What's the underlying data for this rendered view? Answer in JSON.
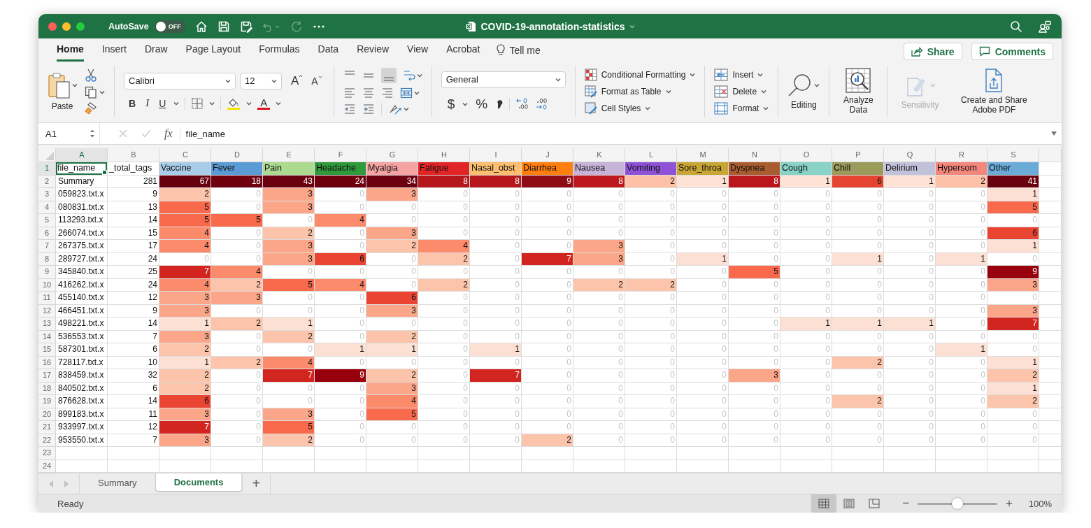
{
  "title_bar": {
    "autosave_label": "AutoSave",
    "autosave": {
      "label": "OFF",
      "on": false
    },
    "document_title": "COVID-19-annotation-statistics"
  },
  "menu_tabs": [
    {
      "label": "Home",
      "selected": true
    },
    {
      "label": "Insert",
      "selected": false
    },
    {
      "label": "Draw",
      "selected": false
    },
    {
      "label": "Page Layout",
      "selected": false
    },
    {
      "label": "Formulas",
      "selected": false
    },
    {
      "label": "Data",
      "selected": false
    },
    {
      "label": "Review",
      "selected": false
    },
    {
      "label": "View",
      "selected": false
    },
    {
      "label": "Acrobat",
      "selected": false
    }
  ],
  "tell_me": "Tell me",
  "header_buttons": [
    {
      "kind": "share",
      "label": "Share"
    },
    {
      "kind": "comments",
      "label": "Comments"
    }
  ],
  "ribbon": {
    "paste": "Paste",
    "font_name": "Calibri",
    "font_size": "12",
    "grow_font": "A",
    "shrink_font": "A",
    "bold": "B",
    "italic": "I",
    "underline": "U",
    "font_color": "A",
    "number_format": "General",
    "currency": "$",
    "percent": "%",
    "styles": [
      {
        "kind": "conditional",
        "label": "Conditional Formatting"
      },
      {
        "kind": "table",
        "label": "Format as Table"
      },
      {
        "kind": "cellstyles",
        "label": "Cell Styles"
      }
    ],
    "cells": [
      {
        "kind": "insert",
        "label": "Insert"
      },
      {
        "kind": "delete",
        "label": "Delete"
      },
      {
        "kind": "format",
        "label": "Format"
      }
    ],
    "editing": "Editing",
    "analyze": "Analyze Data",
    "sensitivity": {
      "label": "Sensitivity",
      "disabled": true
    },
    "adobe": "Create and Share Adobe PDF"
  },
  "formula_bar": {
    "name_box": "A1",
    "fx": "fx",
    "content": "file_name"
  },
  "sheet": {
    "column_letters": [
      "A",
      "B",
      "C",
      "D",
      "E",
      "F",
      "G",
      "H",
      "I",
      "J",
      "K",
      "L",
      "M",
      "N",
      "O",
      "P",
      "Q",
      "R",
      "S"
    ],
    "row_numbers": [
      "1",
      "2",
      "3",
      "4",
      "5",
      "6",
      "7",
      "8",
      "9",
      "10",
      "11",
      "12",
      "13",
      "14",
      "15",
      "16",
      "17",
      "18",
      "19",
      "20",
      "21",
      "22",
      "23",
      "24"
    ],
    "header_row": [
      {
        "text": "file_name",
        "color": "#ffffff",
        "selected": true
      },
      {
        "text": "_total_tags",
        "color": "#ffffff",
        "selected": false
      },
      {
        "text": "Vaccine",
        "color": "#a9cde8",
        "selected": false
      },
      {
        "text": "Fever",
        "color": "#5b9bd5",
        "selected": false
      },
      {
        "text": "Pain",
        "color": "#acda8e",
        "selected": false
      },
      {
        "text": "Headache",
        "color": "#2f9a3c",
        "selected": false
      },
      {
        "text": "Myalgia",
        "color": "#f5a3a3",
        "selected": false
      },
      {
        "text": "Fatigue",
        "color": "#e32426",
        "selected": false
      },
      {
        "text": "Nasal_obst",
        "color": "#fdbf6f",
        "selected": false
      },
      {
        "text": "Diarrhea",
        "color": "#ff7f0e",
        "selected": false
      },
      {
        "text": "Nausea",
        "color": "#c7b2d8",
        "selected": false
      },
      {
        "text": "Vomiting",
        "color": "#8f52d6",
        "selected": false
      },
      {
        "text": "Sore_throa",
        "color": "#c9a634",
        "selected": false
      },
      {
        "text": "Dyspnea",
        "color": "#a95c2e",
        "selected": false
      },
      {
        "text": "Cough",
        "color": "#88d2c7",
        "selected": false
      },
      {
        "text": "Chill",
        "color": "#9b9b5c",
        "selected": false
      },
      {
        "text": "Delirium",
        "color": "#c2c1da",
        "selected": false
      },
      {
        "text": "Hypersom",
        "color": "#f4877c",
        "selected": false
      },
      {
        "text": "Other",
        "color": "#6babd8",
        "selected": false
      }
    ],
    "rows": [
      {
        "file_name": "Summary",
        "total_tags": "281",
        "cells": [
          {
            "text": "67",
            "color": "#67000d"
          },
          {
            "text": "18",
            "color": "#6f010f"
          },
          {
            "text": "43",
            "color": "#6a000e"
          },
          {
            "text": "24",
            "color": "#6e000e"
          },
          {
            "text": "34",
            "color": "#6c000e"
          },
          {
            "text": "8",
            "color": "#b5171c"
          },
          {
            "text": "8",
            "color": "#b5171c"
          },
          {
            "text": "9",
            "color": "#8e0c13"
          },
          {
            "text": "8",
            "color": "#bd181d"
          },
          {
            "text": "2",
            "color": "#fcc1a6"
          },
          {
            "text": "1",
            "color": "#fee2d6"
          },
          {
            "text": "8",
            "color": "#ba171c"
          },
          {
            "text": "1",
            "color": "#fee2d6"
          },
          {
            "text": "6",
            "color": "#e54431"
          },
          {
            "text": "1",
            "color": "#fee2d6"
          },
          {
            "text": "2",
            "color": "#fcc1a6"
          },
          {
            "text": "41",
            "color": "#68000e"
          }
        ]
      },
      {
        "file_name": "059823.txt.x",
        "total_tags": "9",
        "cells": [
          {
            "text": "2",
            "color": "#fcc4ab"
          },
          {
            "text": "0"
          },
          {
            "text": "3",
            "color": "#fca689"
          },
          {
            "text": "0"
          },
          {
            "text": "3",
            "color": "#fca689"
          },
          {
            "text": "0"
          },
          {
            "text": "0"
          },
          {
            "text": "0"
          },
          {
            "text": "0"
          },
          {
            "text": "0"
          },
          {
            "text": "0"
          },
          {
            "text": "0"
          },
          {
            "text": "0"
          },
          {
            "text": "0"
          },
          {
            "text": "0"
          },
          {
            "text": "0"
          },
          {
            "text": "1",
            "color": "#fde0d4"
          }
        ]
      },
      {
        "file_name": "080831.txt.x",
        "total_tags": "13",
        "cells": [
          {
            "text": "5",
            "color": "#f96a4c"
          },
          {
            "text": "0"
          },
          {
            "text": "3",
            "color": "#fca689"
          },
          {
            "text": "0"
          },
          {
            "text": "0"
          },
          {
            "text": "0"
          },
          {
            "text": "0"
          },
          {
            "text": "0"
          },
          {
            "text": "0"
          },
          {
            "text": "0"
          },
          {
            "text": "0"
          },
          {
            "text": "0"
          },
          {
            "text": "0"
          },
          {
            "text": "0"
          },
          {
            "text": "0"
          },
          {
            "text": "0"
          },
          {
            "text": "5",
            "color": "#f96a4c"
          }
        ]
      },
      {
        "file_name": "113293.txt.x",
        "total_tags": "14",
        "cells": [
          {
            "text": "5",
            "color": "#f96a4c"
          },
          {
            "text": "5",
            "color": "#f96a4c"
          },
          {
            "text": "0"
          },
          {
            "text": "4",
            "color": "#fc8b6c"
          },
          {
            "text": "0"
          },
          {
            "text": "0"
          },
          {
            "text": "0"
          },
          {
            "text": "0"
          },
          {
            "text": "0"
          },
          {
            "text": "0"
          },
          {
            "text": "0"
          },
          {
            "text": "0"
          },
          {
            "text": "0"
          },
          {
            "text": "0"
          },
          {
            "text": "0"
          },
          {
            "text": "0"
          },
          {
            "text": "0"
          }
        ]
      },
      {
        "file_name": "266074.txt.x",
        "total_tags": "15",
        "cells": [
          {
            "text": "4",
            "color": "#fc8b6c"
          },
          {
            "text": "0"
          },
          {
            "text": "2",
            "color": "#fcc4ab"
          },
          {
            "text": "0"
          },
          {
            "text": "3",
            "color": "#fca689"
          },
          {
            "text": "0"
          },
          {
            "text": "0"
          },
          {
            "text": "0"
          },
          {
            "text": "0"
          },
          {
            "text": "0"
          },
          {
            "text": "0"
          },
          {
            "text": "0"
          },
          {
            "text": "0"
          },
          {
            "text": "0"
          },
          {
            "text": "0"
          },
          {
            "text": "0"
          },
          {
            "text": "6",
            "color": "#ea4532"
          }
        ]
      },
      {
        "file_name": "267375.txt.x",
        "total_tags": "17",
        "cells": [
          {
            "text": "4",
            "color": "#fc8b6c"
          },
          {
            "text": "0"
          },
          {
            "text": "3",
            "color": "#fca689"
          },
          {
            "text": "0"
          },
          {
            "text": "2",
            "color": "#fcc4ab"
          },
          {
            "text": "4",
            "color": "#fc8b6c"
          },
          {
            "text": "0"
          },
          {
            "text": "0"
          },
          {
            "text": "3",
            "color": "#fca689"
          },
          {
            "text": "0"
          },
          {
            "text": "0"
          },
          {
            "text": "0"
          },
          {
            "text": "0"
          },
          {
            "text": "0"
          },
          {
            "text": "0"
          },
          {
            "text": "0"
          },
          {
            "text": "1",
            "color": "#fde0d4"
          }
        ]
      },
      {
        "file_name": "289727.txt.x",
        "total_tags": "24",
        "cells": [
          {
            "text": "0"
          },
          {
            "text": "0"
          },
          {
            "text": "3",
            "color": "#fca689"
          },
          {
            "text": "6",
            "color": "#ea4532"
          },
          {
            "text": "0"
          },
          {
            "text": "2",
            "color": "#fcc4ab"
          },
          {
            "text": "0"
          },
          {
            "text": "7",
            "color": "#d3251f"
          },
          {
            "text": "3",
            "color": "#fca689"
          },
          {
            "text": "0"
          },
          {
            "text": "1",
            "color": "#fde0d4"
          },
          {
            "text": "0"
          },
          {
            "text": "0"
          },
          {
            "text": "1",
            "color": "#fde0d4"
          },
          {
            "text": "0"
          },
          {
            "text": "1",
            "color": "#fde0d4"
          },
          {
            "text": "0"
          }
        ]
      },
      {
        "file_name": "345840.txt.x",
        "total_tags": "25",
        "cells": [
          {
            "text": "7",
            "color": "#d3251f"
          },
          {
            "text": "4",
            "color": "#fc8b6c"
          },
          {
            "text": "0"
          },
          {
            "text": "0"
          },
          {
            "text": "0"
          },
          {
            "text": "0"
          },
          {
            "text": "0"
          },
          {
            "text": "0"
          },
          {
            "text": "0"
          },
          {
            "text": "0"
          },
          {
            "text": "0"
          },
          {
            "text": "5",
            "color": "#f96a4c"
          },
          {
            "text": "0"
          },
          {
            "text": "0"
          },
          {
            "text": "0"
          },
          {
            "text": "0"
          },
          {
            "text": "9",
            "color": "#99000d"
          }
        ]
      },
      {
        "file_name": "416262.txt.x",
        "total_tags": "24",
        "cells": [
          {
            "text": "4",
            "color": "#fc8b6c"
          },
          {
            "text": "2",
            "color": "#fcc4ab"
          },
          {
            "text": "5",
            "color": "#f96a4c"
          },
          {
            "text": "4",
            "color": "#fc8b6c"
          },
          {
            "text": "0"
          },
          {
            "text": "2",
            "color": "#fcc4ab"
          },
          {
            "text": "0"
          },
          {
            "text": "0"
          },
          {
            "text": "2",
            "color": "#fcc4ab"
          },
          {
            "text": "2",
            "color": "#fcc4ab"
          },
          {
            "text": "0"
          },
          {
            "text": "0"
          },
          {
            "text": "0"
          },
          {
            "text": "0"
          },
          {
            "text": "0"
          },
          {
            "text": "0"
          },
          {
            "text": "3",
            "color": "#fca689"
          }
        ]
      },
      {
        "file_name": "455140.txt.x",
        "total_tags": "12",
        "cells": [
          {
            "text": "3",
            "color": "#fca689"
          },
          {
            "text": "3",
            "color": "#fca689"
          },
          {
            "text": "0"
          },
          {
            "text": "0"
          },
          {
            "text": "6",
            "color": "#ea4532"
          },
          {
            "text": "0"
          },
          {
            "text": "0"
          },
          {
            "text": "0"
          },
          {
            "text": "0"
          },
          {
            "text": "0"
          },
          {
            "text": "0"
          },
          {
            "text": "0"
          },
          {
            "text": "0"
          },
          {
            "text": "0"
          },
          {
            "text": "0"
          },
          {
            "text": "0"
          },
          {
            "text": "0"
          }
        ]
      },
      {
        "file_name": "466451.txt.x",
        "total_tags": "9",
        "cells": [
          {
            "text": "3",
            "color": "#fca689"
          },
          {
            "text": "0"
          },
          {
            "text": "0"
          },
          {
            "text": "0"
          },
          {
            "text": "3",
            "color": "#fca689"
          },
          {
            "text": "0"
          },
          {
            "text": "0"
          },
          {
            "text": "0"
          },
          {
            "text": "0"
          },
          {
            "text": "0"
          },
          {
            "text": "0"
          },
          {
            "text": "0"
          },
          {
            "text": "0"
          },
          {
            "text": "0"
          },
          {
            "text": "0"
          },
          {
            "text": "0"
          },
          {
            "text": "3",
            "color": "#fca689"
          }
        ]
      },
      {
        "file_name": "498221.txt.x",
        "total_tags": "14",
        "cells": [
          {
            "text": "1",
            "color": "#fde0d4"
          },
          {
            "text": "2",
            "color": "#fcc4ab"
          },
          {
            "text": "1",
            "color": "#fde0d4"
          },
          {
            "text": "0"
          },
          {
            "text": "0"
          },
          {
            "text": "0"
          },
          {
            "text": "0"
          },
          {
            "text": "0"
          },
          {
            "text": "0"
          },
          {
            "text": "0"
          },
          {
            "text": "0"
          },
          {
            "text": "0"
          },
          {
            "text": "1",
            "color": "#fde0d4"
          },
          {
            "text": "1",
            "color": "#fde0d4"
          },
          {
            "text": "1",
            "color": "#fde0d4"
          },
          {
            "text": "0"
          },
          {
            "text": "7",
            "color": "#d3251f"
          }
        ]
      },
      {
        "file_name": "536553.txt.x",
        "total_tags": "7",
        "cells": [
          {
            "text": "3",
            "color": "#fca689"
          },
          {
            "text": "0"
          },
          {
            "text": "2",
            "color": "#fcc4ab"
          },
          {
            "text": "0"
          },
          {
            "text": "2",
            "color": "#fcc4ab"
          },
          {
            "text": "0"
          },
          {
            "text": "0"
          },
          {
            "text": "0"
          },
          {
            "text": "0"
          },
          {
            "text": "0"
          },
          {
            "text": "0"
          },
          {
            "text": "0"
          },
          {
            "text": "0"
          },
          {
            "text": "0"
          },
          {
            "text": "0"
          },
          {
            "text": "0"
          },
          {
            "text": "0"
          }
        ]
      },
      {
        "file_name": "587301.txt.x",
        "total_tags": "6",
        "cells": [
          {
            "text": "2",
            "color": "#fcc4ab"
          },
          {
            "text": "0"
          },
          {
            "text": "0"
          },
          {
            "text": "1",
            "color": "#fde0d4"
          },
          {
            "text": "1",
            "color": "#fde0d4"
          },
          {
            "text": "0"
          },
          {
            "text": "1",
            "color": "#fde0d4"
          },
          {
            "text": "0"
          },
          {
            "text": "0"
          },
          {
            "text": "0"
          },
          {
            "text": "0"
          },
          {
            "text": "0"
          },
          {
            "text": "0"
          },
          {
            "text": "0"
          },
          {
            "text": "0"
          },
          {
            "text": "1",
            "color": "#fde0d4"
          },
          {
            "text": "0"
          }
        ]
      },
      {
        "file_name": "728117.txt.x",
        "total_tags": "10",
        "cells": [
          {
            "text": "1",
            "color": "#fde0d4"
          },
          {
            "text": "2",
            "color": "#fcc4ab"
          },
          {
            "text": "4",
            "color": "#fc8b6c"
          },
          {
            "text": "0"
          },
          {
            "text": "0"
          },
          {
            "text": "0"
          },
          {
            "text": "0"
          },
          {
            "text": "0"
          },
          {
            "text": "0"
          },
          {
            "text": "0"
          },
          {
            "text": "0"
          },
          {
            "text": "0"
          },
          {
            "text": "0"
          },
          {
            "text": "2",
            "color": "#fcc4ab"
          },
          {
            "text": "0"
          },
          {
            "text": "0"
          },
          {
            "text": "1",
            "color": "#fde0d4"
          }
        ]
      },
      {
        "file_name": "838459.txt.x",
        "total_tags": "32",
        "cells": [
          {
            "text": "2",
            "color": "#fcc4ab"
          },
          {
            "text": "0"
          },
          {
            "text": "7",
            "color": "#d3251f"
          },
          {
            "text": "9",
            "color": "#99000d"
          },
          {
            "text": "2",
            "color": "#fcc4ab"
          },
          {
            "text": "0"
          },
          {
            "text": "7",
            "color": "#d3251f"
          },
          {
            "text": "0"
          },
          {
            "text": "0"
          },
          {
            "text": "0"
          },
          {
            "text": "0"
          },
          {
            "text": "3",
            "color": "#fca689"
          },
          {
            "text": "0"
          },
          {
            "text": "0"
          },
          {
            "text": "0"
          },
          {
            "text": "0"
          },
          {
            "text": "2",
            "color": "#fcc4ab"
          }
        ]
      },
      {
        "file_name": "840502.txt.x",
        "total_tags": "6",
        "cells": [
          {
            "text": "2",
            "color": "#fcc4ab"
          },
          {
            "text": "0"
          },
          {
            "text": "0"
          },
          {
            "text": "0"
          },
          {
            "text": "3",
            "color": "#fca689"
          },
          {
            "text": "0"
          },
          {
            "text": "0"
          },
          {
            "text": "0"
          },
          {
            "text": "0"
          },
          {
            "text": "0"
          },
          {
            "text": "0"
          },
          {
            "text": "0"
          },
          {
            "text": "0"
          },
          {
            "text": "0"
          },
          {
            "text": "0"
          },
          {
            "text": "0"
          },
          {
            "text": "1",
            "color": "#fde0d4"
          }
        ]
      },
      {
        "file_name": "876628.txt.x",
        "total_tags": "14",
        "cells": [
          {
            "text": "6",
            "color": "#ea4532"
          },
          {
            "text": "0"
          },
          {
            "text": "0"
          },
          {
            "text": "0"
          },
          {
            "text": "4",
            "color": "#fc8b6c"
          },
          {
            "text": "0"
          },
          {
            "text": "0"
          },
          {
            "text": "0"
          },
          {
            "text": "0"
          },
          {
            "text": "0"
          },
          {
            "text": "0"
          },
          {
            "text": "0"
          },
          {
            "text": "0"
          },
          {
            "text": "2",
            "color": "#fcc4ab"
          },
          {
            "text": "0"
          },
          {
            "text": "0"
          },
          {
            "text": "2",
            "color": "#fcc4ab"
          }
        ]
      },
      {
        "file_name": "899183.txt.x",
        "total_tags": "11",
        "cells": [
          {
            "text": "3",
            "color": "#fca689"
          },
          {
            "text": "0"
          },
          {
            "text": "3",
            "color": "#fca689"
          },
          {
            "text": "0"
          },
          {
            "text": "5",
            "color": "#f96a4c"
          },
          {
            "text": "0"
          },
          {
            "text": "0"
          },
          {
            "text": "0"
          },
          {
            "text": "0"
          },
          {
            "text": "0"
          },
          {
            "text": "0"
          },
          {
            "text": "0"
          },
          {
            "text": "0"
          },
          {
            "text": "0"
          },
          {
            "text": "0"
          },
          {
            "text": "0"
          },
          {
            "text": "0"
          }
        ]
      },
      {
        "file_name": "933997.txt.x",
        "total_tags": "12",
        "cells": [
          {
            "text": "7",
            "color": "#d3251f"
          },
          {
            "text": "0"
          },
          {
            "text": "5",
            "color": "#f96a4c"
          },
          {
            "text": "0"
          },
          {
            "text": "0"
          },
          {
            "text": "0"
          },
          {
            "text": "0"
          },
          {
            "text": "0"
          },
          {
            "text": "0"
          },
          {
            "text": "0"
          },
          {
            "text": "0"
          },
          {
            "text": "0"
          },
          {
            "text": "0"
          },
          {
            "text": "0"
          },
          {
            "text": "0"
          },
          {
            "text": "0"
          },
          {
            "text": "0"
          }
        ]
      },
      {
        "file_name": "953550.txt.x",
        "total_tags": "7",
        "cells": [
          {
            "text": "3",
            "color": "#fca689"
          },
          {
            "text": "0"
          },
          {
            "text": "2",
            "color": "#fcc4ab"
          },
          {
            "text": "0"
          },
          {
            "text": "0"
          },
          {
            "text": "0"
          },
          {
            "text": "0"
          },
          {
            "text": "2",
            "color": "#fcc4ab"
          },
          {
            "text": "0"
          },
          {
            "text": "0"
          },
          {
            "text": "0"
          },
          {
            "text": "0"
          },
          {
            "text": "0"
          },
          {
            "text": "0"
          },
          {
            "text": "0"
          },
          {
            "text": "0"
          },
          {
            "text": "0"
          }
        ]
      }
    ]
  },
  "sheet_tabs": [
    {
      "label": "Summary",
      "selected": false
    },
    {
      "label": "Documents",
      "selected": true
    }
  ],
  "add_sheet": "+",
  "status_bar": {
    "status": "Ready",
    "views": [
      {
        "kind": "normal",
        "selected": true
      },
      {
        "kind": "page_layout",
        "selected": false
      },
      {
        "kind": "page_break",
        "selected": false
      }
    ],
    "zoom_out": "−",
    "zoom_in": "+",
    "zoom": {
      "level": 0.5
    },
    "zoom_label": "100%"
  }
}
